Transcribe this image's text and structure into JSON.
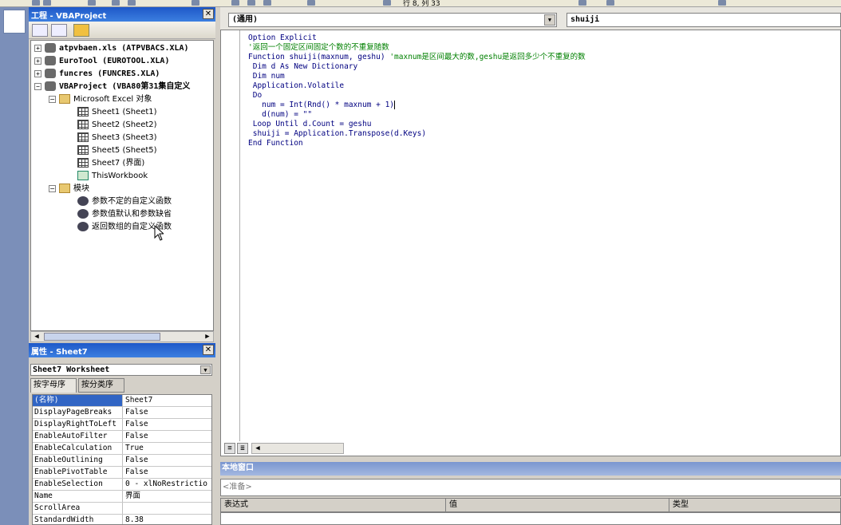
{
  "toolbar": {
    "status": "行 8, 列 33"
  },
  "project": {
    "title": "工程 - VBAProject",
    "nodes": [
      {
        "label": "atpvbaen.xls (ATPVBACS.XLA)",
        "type": "project",
        "bold": true,
        "exp": "+"
      },
      {
        "label": "EuroTool (EUROTOOL.XLA)",
        "type": "project",
        "bold": true,
        "exp": "+"
      },
      {
        "label": "funcres (FUNCRES.XLA)",
        "type": "project",
        "bold": true,
        "exp": "+"
      },
      {
        "label": "VBAProject (VBA80第31集自定义",
        "type": "project",
        "bold": true,
        "exp": "−"
      },
      {
        "label": "Microsoft Excel 对象",
        "type": "folder",
        "exp": "−"
      },
      {
        "label": "Sheet1 (Sheet1)",
        "type": "sheet"
      },
      {
        "label": "Sheet2 (Sheet2)",
        "type": "sheet"
      },
      {
        "label": "Sheet3 (Sheet3)",
        "type": "sheet"
      },
      {
        "label": "Sheet5 (Sheet5)",
        "type": "sheet"
      },
      {
        "label": "Sheet7 (界面)",
        "type": "sheet"
      },
      {
        "label": "ThisWorkbook",
        "type": "workbook"
      },
      {
        "label": "模块",
        "type": "folder",
        "exp": "−"
      },
      {
        "label": "参数不定的自定义函数",
        "type": "module"
      },
      {
        "label": "参数值默认和参数缺省",
        "type": "module"
      },
      {
        "label": "返回数组的自定义函数",
        "type": "module"
      }
    ]
  },
  "properties": {
    "title": "属性 - Sheet7",
    "object": "Sheet7 Worksheet",
    "tabs": [
      "按字母序",
      "按分类序"
    ],
    "rows": [
      {
        "k": "(名称)",
        "v": "Sheet7"
      },
      {
        "k": "DisplayPageBreaks",
        "v": "False"
      },
      {
        "k": "DisplayRightToLeft",
        "v": "False"
      },
      {
        "k": "EnableAutoFilter",
        "v": "False"
      },
      {
        "k": "EnableCalculation",
        "v": "True"
      },
      {
        "k": "EnableOutlining",
        "v": "False"
      },
      {
        "k": "EnablePivotTable",
        "v": "False"
      },
      {
        "k": "EnableSelection",
        "v": "0 - xlNoRestrictio"
      },
      {
        "k": "Name",
        "v": "界面"
      },
      {
        "k": "ScrollArea",
        "v": ""
      },
      {
        "k": "StandardWidth",
        "v": "8.38"
      }
    ]
  },
  "code": {
    "object_combo": "(通用)",
    "proc_combo": "shuiji",
    "lines": [
      {
        "t": "Option Explicit",
        "c": "kw"
      },
      {
        "t": "'返回一个固定区间固定个数的不重复随数",
        "c": "cm"
      },
      {
        "t": "Function shuiji(maxnum, geshu) ",
        "c": "kw",
        "tail": "'maxnum是区间最大的数,geshu是返回多少个不重复的数"
      },
      {
        "t": " Dim d As New Dictionary",
        "c": "kw"
      },
      {
        "t": " Dim num",
        "c": "kw"
      },
      {
        "t": " Application.Volatile",
        "c": "kw"
      },
      {
        "t": " Do",
        "c": "kw"
      },
      {
        "t": "   num = Int(Rnd() * maxnum + 1)",
        "c": "kw",
        "cursor": true
      },
      {
        "t": "   d(num) = \"\"",
        "c": "kw"
      },
      {
        "t": " Loop Until d.Count = geshu",
        "c": "kw"
      },
      {
        "t": " shuiji = Application.Transpose(d.Keys)",
        "c": "kw"
      },
      {
        "t": "End Function",
        "c": "kw"
      }
    ]
  },
  "immediate": {
    "title": "本地窗口",
    "placeholder": "<准备>",
    "columns": [
      "表达式",
      "值",
      "类型"
    ]
  }
}
